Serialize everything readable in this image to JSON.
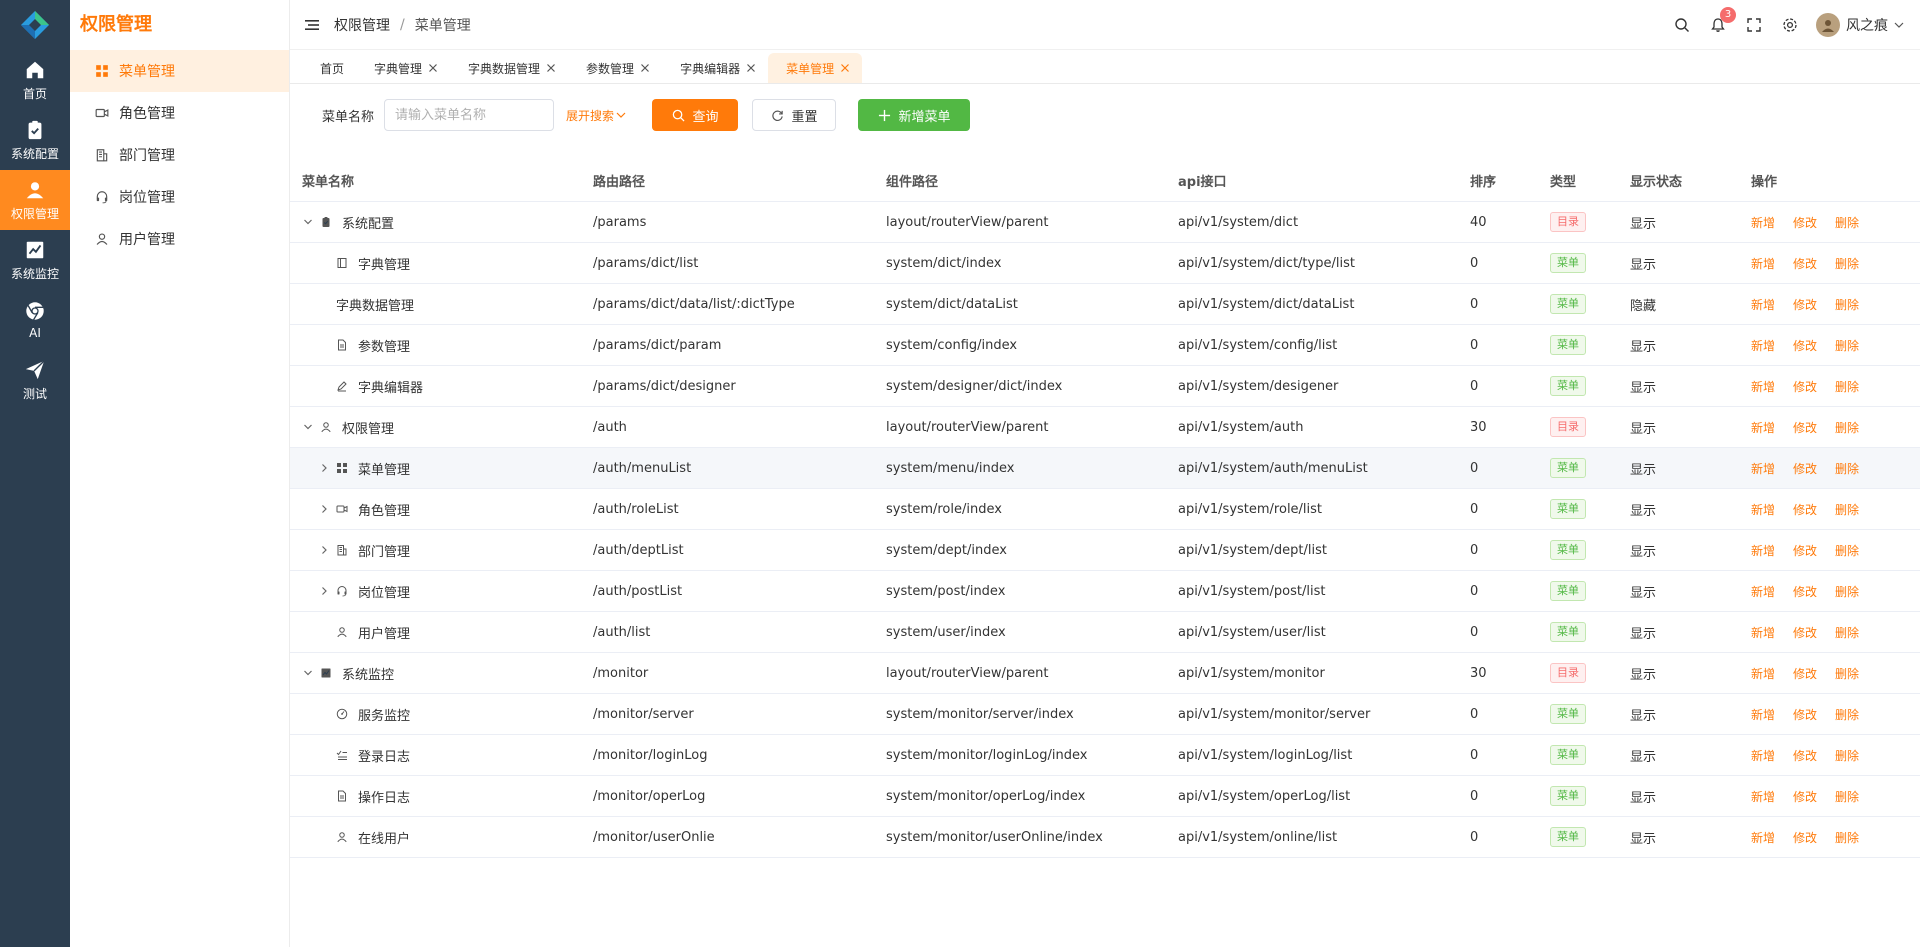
{
  "rail": {
    "items": [
      {
        "label": "首页",
        "icon": "home-icon"
      },
      {
        "label": "系统配置",
        "icon": "clipboard-icon"
      },
      {
        "label": "权限管理",
        "icon": "user-icon",
        "active": true
      },
      {
        "label": "系统监控",
        "icon": "chart-icon"
      },
      {
        "label": "AI",
        "icon": "chrome-icon"
      },
      {
        "label": "测试",
        "icon": "send-icon"
      }
    ]
  },
  "sidebar": {
    "title": "权限管理",
    "items": [
      {
        "label": "菜单管理",
        "icon": "grid-icon",
        "active": true
      },
      {
        "label": "角色管理",
        "icon": "video-icon"
      },
      {
        "label": "部门管理",
        "icon": "building-icon"
      },
      {
        "label": "岗位管理",
        "icon": "headset-icon"
      },
      {
        "label": "用户管理",
        "icon": "person-icon"
      }
    ]
  },
  "header": {
    "breadcrumb": [
      "权限管理",
      "菜单管理"
    ],
    "breadcrumb_sep": "/",
    "notification_count": "3",
    "username": "风之痕"
  },
  "tabs": [
    {
      "label": "首页",
      "closable": false
    },
    {
      "label": "字典管理",
      "closable": true
    },
    {
      "label": "字典数据管理",
      "closable": true
    },
    {
      "label": "参数管理",
      "closable": true
    },
    {
      "label": "字典编辑器",
      "closable": true
    },
    {
      "label": "菜单管理",
      "closable": true,
      "active": true
    }
  ],
  "search": {
    "label": "菜单名称",
    "placeholder": "请输入菜单名称",
    "expand_label": "展开搜索",
    "query_label": "查询",
    "reset_label": "重置",
    "add_label": "新增菜单"
  },
  "table": {
    "columns": [
      "菜单名称",
      "路由路径",
      "组件路径",
      "api接口",
      "排序",
      "类型",
      "显示状态",
      "操作"
    ],
    "ops": [
      "新增",
      "修改",
      "删除"
    ],
    "rows": [
      {
        "name": "系统配置",
        "path": "/params",
        "component": "layout/routerView/parent",
        "api": "api/v1/system/dict",
        "sort": "40",
        "type": "目录",
        "type_kind": "dir",
        "display": "显示",
        "level": 0,
        "caret": "down",
        "icon": "clipboard-icon"
      },
      {
        "name": "字典管理",
        "path": "/params/dict/list",
        "component": "system/dict/index",
        "api": "api/v1/system/dict/type/list",
        "sort": "0",
        "type": "菜单",
        "type_kind": "menu",
        "display": "显示",
        "level": 1,
        "caret": "none",
        "icon": "book-icon"
      },
      {
        "name": "字典数据管理",
        "path": "/params/dict/data/list/:dictType",
        "component": "system/dict/dataList",
        "api": "api/v1/system/dict/dataList",
        "sort": "0",
        "type": "菜单",
        "type_kind": "menu",
        "display": "隐藏",
        "level": 1,
        "caret": "none",
        "icon": ""
      },
      {
        "name": "参数管理",
        "path": "/params/dict/param",
        "component": "system/config/index",
        "api": "api/v1/system/config/list",
        "sort": "0",
        "type": "菜单",
        "type_kind": "menu",
        "display": "显示",
        "level": 1,
        "caret": "none",
        "icon": "doc-icon"
      },
      {
        "name": "字典编辑器",
        "path": "/params/dict/designer",
        "component": "system/designer/dict/index",
        "api": "api/v1/system/desigener",
        "sort": "0",
        "type": "菜单",
        "type_kind": "menu",
        "display": "显示",
        "level": 1,
        "caret": "none",
        "icon": "pen-icon"
      },
      {
        "name": "权限管理",
        "path": "/auth",
        "component": "layout/routerView/parent",
        "api": "api/v1/system/auth",
        "sort": "30",
        "type": "目录",
        "type_kind": "dir",
        "display": "显示",
        "level": 0,
        "caret": "down",
        "icon": "person-icon"
      },
      {
        "name": "菜单管理",
        "path": "/auth/menuList",
        "component": "system/menu/index",
        "api": "api/v1/system/auth/menuList",
        "sort": "0",
        "type": "菜单",
        "type_kind": "menu",
        "display": "显示",
        "level": 1,
        "caret": "right",
        "icon": "grid-icon",
        "highlight": true
      },
      {
        "name": "角色管理",
        "path": "/auth/roleList",
        "component": "system/role/index",
        "api": "api/v1/system/role/list",
        "sort": "0",
        "type": "菜单",
        "type_kind": "menu",
        "display": "显示",
        "level": 1,
        "caret": "right",
        "icon": "video-icon"
      },
      {
        "name": "部门管理",
        "path": "/auth/deptList",
        "component": "system/dept/index",
        "api": "api/v1/system/dept/list",
        "sort": "0",
        "type": "菜单",
        "type_kind": "menu",
        "display": "显示",
        "level": 1,
        "caret": "right",
        "icon": "building-icon"
      },
      {
        "name": "岗位管理",
        "path": "/auth/postList",
        "component": "system/post/index",
        "api": "api/v1/system/post/list",
        "sort": "0",
        "type": "菜单",
        "type_kind": "menu",
        "display": "显示",
        "level": 1,
        "caret": "right",
        "icon": "headset-icon"
      },
      {
        "name": "用户管理",
        "path": "/auth/list",
        "component": "system/user/index",
        "api": "api/v1/system/user/list",
        "sort": "0",
        "type": "菜单",
        "type_kind": "menu",
        "display": "显示",
        "level": 1,
        "caret": "none",
        "icon": "user-outline-icon"
      },
      {
        "name": "系统监控",
        "path": "/monitor",
        "component": "layout/routerView/parent",
        "api": "api/v1/system/monitor",
        "sort": "30",
        "type": "目录",
        "type_kind": "dir",
        "display": "显示",
        "level": 0,
        "caret": "down",
        "icon": "chart-icon"
      },
      {
        "name": "服务监控",
        "path": "/monitor/server",
        "component": "system/monitor/server/index",
        "api": "api/v1/system/monitor/server",
        "sort": "0",
        "type": "菜单",
        "type_kind": "menu",
        "display": "显示",
        "level": 1,
        "caret": "none",
        "icon": "gauge-icon"
      },
      {
        "name": "登录日志",
        "path": "/monitor/loginLog",
        "component": "system/monitor/loginLog/index",
        "api": "api/v1/system/loginLog/list",
        "sort": "0",
        "type": "菜单",
        "type_kind": "menu",
        "display": "显示",
        "level": 1,
        "caret": "none",
        "icon": "list-check-icon"
      },
      {
        "name": "操作日志",
        "path": "/monitor/operLog",
        "component": "system/monitor/operLog/index",
        "api": "api/v1/system/operLog/list",
        "sort": "0",
        "type": "菜单",
        "type_kind": "menu",
        "display": "显示",
        "level": 1,
        "caret": "none",
        "icon": "doc-icon"
      },
      {
        "name": "在线用户",
        "path": "/monitor/userOnlie",
        "component": "system/monitor/userOnline/index",
        "api": "api/v1/system/online/list",
        "sort": "0",
        "type": "菜单",
        "type_kind": "menu",
        "display": "显示",
        "level": 1,
        "caret": "none",
        "icon": "user-outline-icon"
      }
    ]
  },
  "colors": {
    "accent": "#ff7a0a",
    "rail_bg": "#2c3e50",
    "add_button": "#52b844",
    "tag_dir": "#f56c6c",
    "tag_menu": "#52b844"
  }
}
